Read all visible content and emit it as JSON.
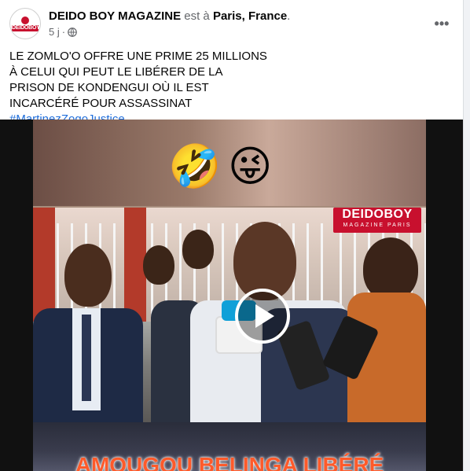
{
  "post": {
    "author": "DEIDO BOY MAGAZINE",
    "location_prefix": "est à",
    "location": "Paris, France",
    "location_suffix": ".",
    "time": "5 j",
    "separator": "·",
    "privacy_icon": "globe-icon",
    "more_icon": "more-options-icon",
    "more_symbol": "•••",
    "avatar_text": "DEIDOBOY",
    "caption": "LE ZOMLO'O OFFRE UNE PRIME 25 MILLIONS À CELUI QUI PEUT LE LIBÉRER DE LA PRISON DE KONDENGUI OÙ IL EST INCARCÉRÉ POUR ASSASSINAT",
    "hashtag": "#MartinezZogoJustice"
  },
  "video": {
    "emoji_1": "🤣",
    "emoji_2": "😜",
    "watermark_title": "DEIDOBOY",
    "watermark_subtitle": "MAGAZINE PARIS",
    "overlay_text": "AMOUGOU BELINGA LIBÉRÉ",
    "play_icon": "play-icon"
  },
  "colors": {
    "brand_red": "#c8102e",
    "link_blue": "#216fdb",
    "meta_gray": "#65676b",
    "overlay_orange": "#ff5a2a"
  }
}
